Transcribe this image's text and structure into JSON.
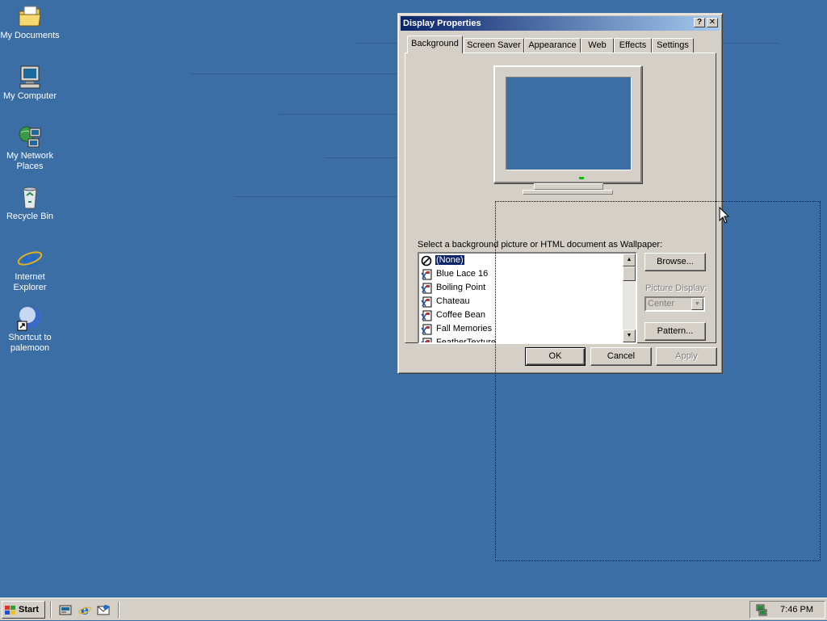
{
  "desktop": {
    "icons": [
      {
        "label": "My Documents",
        "icon": "folder-documents-icon"
      },
      {
        "label": "My Computer",
        "icon": "computer-icon"
      },
      {
        "label": "My Network Places",
        "icon": "network-icon"
      },
      {
        "label": "Recycle Bin",
        "icon": "recycle-bin-icon"
      },
      {
        "label": "Internet Explorer",
        "icon": "internet-explorer-icon"
      },
      {
        "label": "Shortcut to palemoon",
        "icon": "palemoon-icon"
      }
    ]
  },
  "window": {
    "title": "Display Properties",
    "help_label": "?",
    "close_label": "✕",
    "tabs": [
      "Background",
      "Screen Saver",
      "Appearance",
      "Web",
      "Effects",
      "Settings"
    ],
    "active_tab": "Background",
    "prompt": "Select a background picture or HTML document as Wallpaper:",
    "wallpapers": [
      "(None)",
      "Blue Lace 16",
      "Boiling Point",
      "Chateau",
      "Coffee Bean",
      "Fall Memories",
      "FeatherTexture"
    ],
    "selected_wallpaper": "(None)",
    "browse_label": "Browse...",
    "picture_display_label": "Picture Display:",
    "picture_display_value": "Center",
    "pattern_label": "Pattern...",
    "ok_label": "OK",
    "cancel_label": "Cancel",
    "apply_label": "Apply"
  },
  "taskbar": {
    "start_label": "Start",
    "clock": "7:46 PM"
  },
  "colors": {
    "desktop": "#3a6ea5",
    "titlebar_start": "#0a246a",
    "titlebar_end": "#a6caf0",
    "face": "#d4d0c8"
  }
}
